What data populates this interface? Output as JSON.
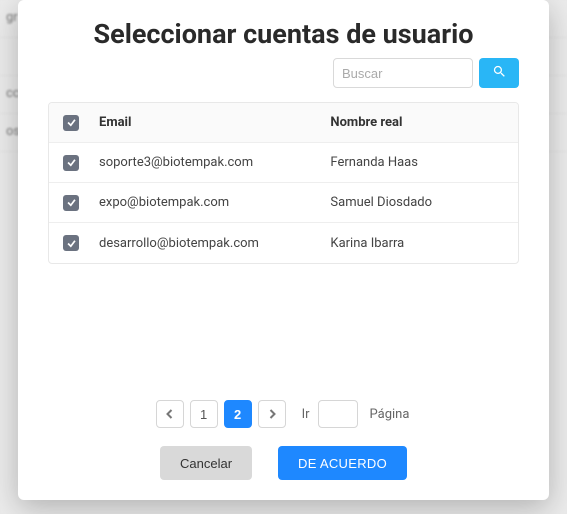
{
  "modal": {
    "title": "Seleccionar cuentas de usuario",
    "search": {
      "placeholder": "Buscar"
    },
    "table": {
      "headers": {
        "email": "Email",
        "name": "Nombre real"
      },
      "rows": [
        {
          "email": "soporte3@biotempak.com",
          "name": "Fernanda Haas"
        },
        {
          "email": "expo@biotempak.com",
          "name": "Samuel Diosdado"
        },
        {
          "email": "desarrollo@biotempak.com",
          "name": "Karina Ibarra"
        }
      ]
    },
    "pager": {
      "pages": [
        "1",
        "2"
      ],
      "active": "2",
      "go_label": "Ir",
      "page_label": "Página"
    },
    "actions": {
      "cancel": "Cancelar",
      "ok": "DE ACUERDO"
    }
  }
}
